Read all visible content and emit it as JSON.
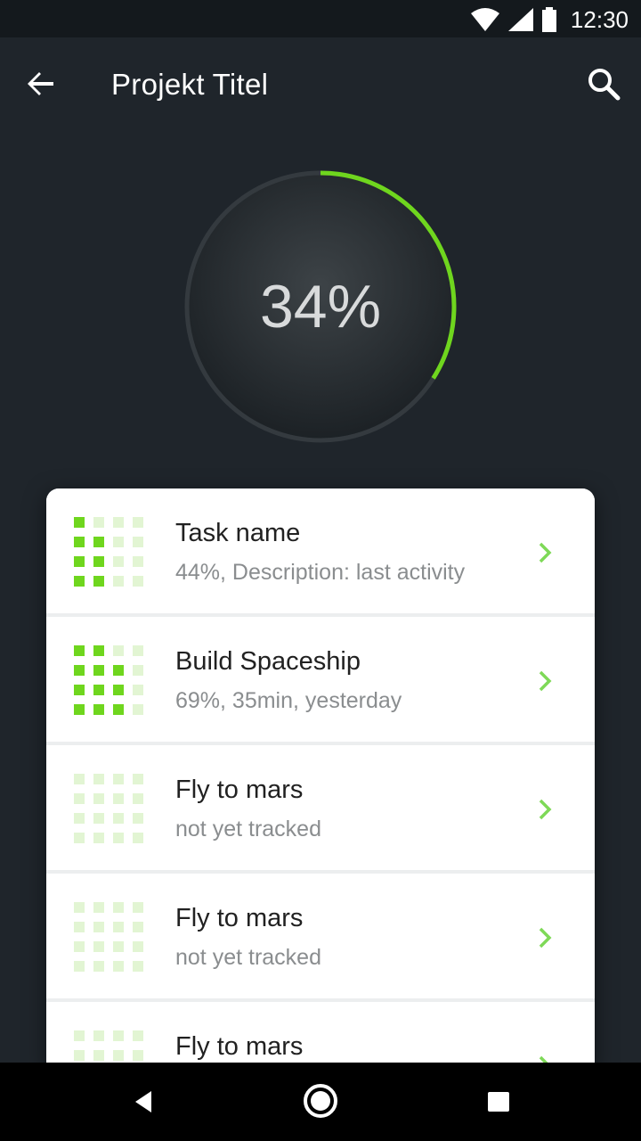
{
  "status_bar": {
    "time": "12:30"
  },
  "app_bar": {
    "title": "Projekt Titel",
    "back_icon": "arrow-left-icon",
    "search_icon": "search-icon"
  },
  "progress": {
    "label": "34%",
    "value": 0.34,
    "ring_color": "#6fd61e",
    "track_color": "#343a3f"
  },
  "tasks": [
    {
      "name": "Task name",
      "subtitle": "44%, Description: last activity",
      "progress": 0.44
    },
    {
      "name": "Build Spaceship",
      "subtitle": "69%, 35min, yesterday",
      "progress": 0.69
    },
    {
      "name": "Fly to mars",
      "subtitle": "not yet tracked",
      "progress": 0
    },
    {
      "name": "Fly to mars",
      "subtitle": "not yet tracked",
      "progress": 0
    },
    {
      "name": "Fly to mars",
      "subtitle": "",
      "progress": 0
    }
  ],
  "colors": {
    "accent": "#6fd61e",
    "grid_off": "#e2f5d3",
    "chevron": "#7ed957"
  }
}
